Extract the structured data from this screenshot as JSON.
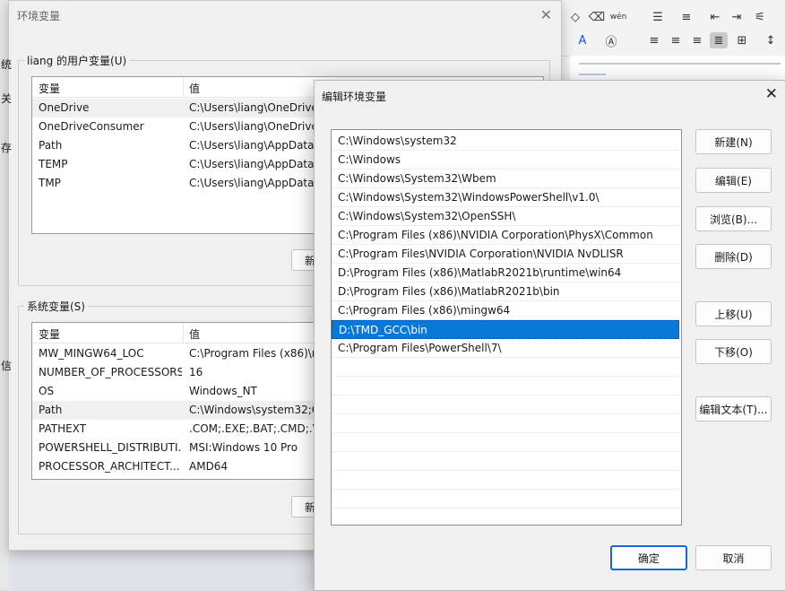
{
  "env_dialog": {
    "title": "环境变量",
    "user_group_label": "liang 的用户变量(U)",
    "system_group_label": "系统变量(S)",
    "col_variable": "变量",
    "col_value": "值",
    "user_vars": [
      {
        "name": "OneDrive",
        "value": "C:\\Users\\liang\\OneDrive"
      },
      {
        "name": "OneDriveConsumer",
        "value": "C:\\Users\\liang\\OneDrive"
      },
      {
        "name": "Path",
        "value": "C:\\Users\\liang\\AppData\\"
      },
      {
        "name": "TEMP",
        "value": "C:\\Users\\liang\\AppData\\"
      },
      {
        "name": "TMP",
        "value": "C:\\Users\\liang\\AppData\\"
      }
    ],
    "system_vars": [
      {
        "name": "MW_MINGW64_LOC",
        "value": "C:\\Program Files (x86)\\m"
      },
      {
        "name": "NUMBER_OF_PROCESSORS",
        "value": "16"
      },
      {
        "name": "OS",
        "value": "Windows_NT"
      },
      {
        "name": "Path",
        "value": "C:\\Windows\\system32;C:"
      },
      {
        "name": "PATHEXT",
        "value": ".COM;.EXE;.BAT;.CMD;.VI"
      },
      {
        "name": "POWERSHELL_DISTRIBUTI...",
        "value": "MSI:Windows 10 Pro"
      },
      {
        "name": "PROCESSOR_ARCHITECT...",
        "value": "AMD64"
      }
    ],
    "user_new_label": "新",
    "system_new_label": "新",
    "side_chars": [
      "统",
      "关",
      "存",
      "信"
    ]
  },
  "edit_dialog": {
    "title": "编辑环境变量",
    "entries": [
      "C:\\Windows\\system32",
      "C:\\Windows",
      "C:\\Windows\\System32\\Wbem",
      "C:\\Windows\\System32\\WindowsPowerShell\\v1.0\\",
      "C:\\Windows\\System32\\OpenSSH\\",
      "C:\\Program Files (x86)\\NVIDIA Corporation\\PhysX\\Common",
      "C:\\Program Files\\NVIDIA Corporation\\NVIDIA NvDLISR",
      "D:\\Program Files (x86)\\MatlabR2021b\\runtime\\win64",
      "D:\\Program Files (x86)\\MatlabR2021b\\bin",
      "C:\\Program Files (x86)\\mingw64",
      "D:\\TMD_GCC\\bin",
      "C:\\Program Files\\PowerShell\\7\\"
    ],
    "selected_index": 10,
    "buttons": {
      "new": "新建(N)",
      "edit": "编辑(E)",
      "browse": "浏览(B)...",
      "delete": "删除(D)",
      "move_up": "上移(U)",
      "move_down": "下移(O)",
      "edit_text": "编辑文本(T)..."
    },
    "ok": "确定",
    "cancel": "取消"
  },
  "colors": {
    "selection": "#0a78d7",
    "ok_border": "#1967d2"
  }
}
